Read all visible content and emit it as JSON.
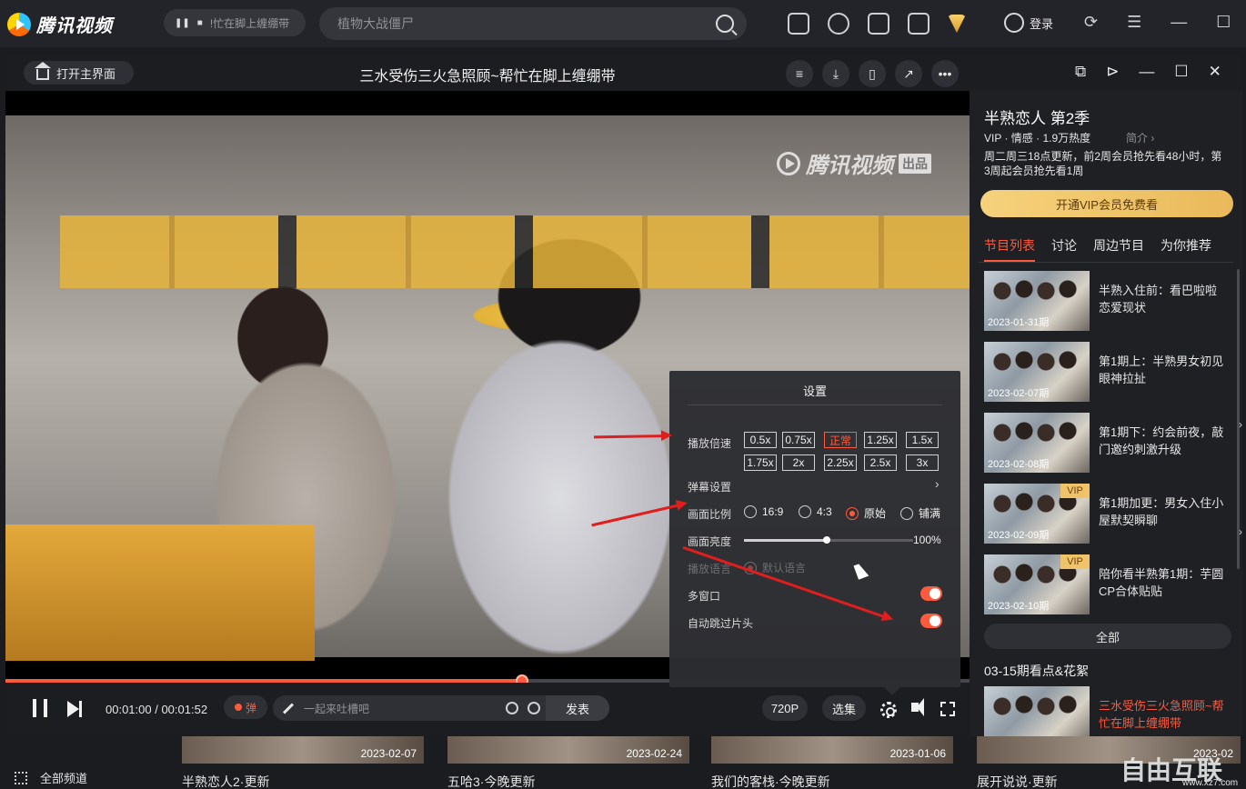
{
  "app": {
    "logo_text": "腾讯视频",
    "mini_player_text": "!忙在脚上缠绷带",
    "search_placeholder": "植物大战僵尸",
    "login_label": "登录"
  },
  "player": {
    "home_label": "打开主界面",
    "title": "三水受伤三火急照顾~帮忙在脚上缠绷带",
    "watermark_text": "腾讯视频",
    "watermark_badge": "出品",
    "time": "00:01:00 / 00:01:52",
    "progress_fraction": 0.536,
    "danmu_label": "弹",
    "danmu_placeholder": "一起来吐槽吧",
    "send_label": "发表",
    "quality_label": "720P",
    "episodes_label": "选集"
  },
  "settings": {
    "title": "设置",
    "speed_label": "播放倍速",
    "speeds_row1": [
      "0.5x",
      "0.75x",
      "正常",
      "1.25x",
      "1.5x"
    ],
    "speeds_row2": [
      "1.75x",
      "2x",
      "2.25x",
      "2.5x",
      "3x"
    ],
    "active_speed": "正常",
    "danmu_settings_label": "弹幕设置",
    "ratio_label": "画面比例",
    "ratios": [
      "16:9",
      "4:3",
      "原始",
      "铺满"
    ],
    "active_ratio": "原始",
    "brightness_label": "画面亮度",
    "brightness_value": "100%",
    "brightness_fraction": 0.49,
    "language_label": "播放语言",
    "language_value": "默认语言",
    "multiwindow_label": "多窗口",
    "skip_intro_label": "自动跳过片头"
  },
  "sidebar": {
    "show_title": "半熟恋人 第2季",
    "meta": "VIP · 情感 · 1.9万热度",
    "intro_label": "简介 ›",
    "schedule": "周二周三18点更新，前2周会员抢先看48小时，第3周起会员抢先看1周",
    "vip_button": "开通VIP会员免费看",
    "tabs": [
      "节目列表",
      "讨论",
      "周边节目",
      "为你推荐"
    ],
    "episodes": [
      {
        "date": "2023-01-31期",
        "title": "半熟入住前：看巴啦啦恋爱现状",
        "vip": false
      },
      {
        "date": "2023-02-07期",
        "title": "第1期上：半熟男女初见眼神拉扯",
        "vip": false
      },
      {
        "date": "2023-02-08期",
        "title": "第1期下：约会前夜，敲门邀约刺激升级",
        "vip": false
      },
      {
        "date": "2023-02-09期",
        "title": "第1期加更：男女入住小屋默契瞬聊",
        "vip": true
      },
      {
        "date": "2023-02-10期",
        "title": "陪你看半熟第1期：芋圆CP合体贴贴",
        "vip": true
      }
    ],
    "vip_tag": "VIP",
    "all_label": "全部",
    "section_title": "03-15期看点&花絮",
    "current_clip": {
      "title": "三水受伤三火急照顾~帮忙在脚上缠绷带"
    }
  },
  "background": {
    "cards": [
      {
        "date": "2023-02-07",
        "title": "半熟恋人2·更新"
      },
      {
        "date": "2023-02-24",
        "title": "五哈3·今晚更新"
      },
      {
        "date": "2023-01-06",
        "title": "我们的客栈·今晚更新"
      },
      {
        "date": "2023-02",
        "title": "展开说说·更新"
      }
    ],
    "all_channels": "全部频道",
    "site_logo": "自由互联",
    "site_url": "www.xz7.com"
  },
  "colors": {
    "accent": "#ff5a3c",
    "vip_gold": "#f0c36a",
    "annotation_red": "#e01e1e"
  }
}
